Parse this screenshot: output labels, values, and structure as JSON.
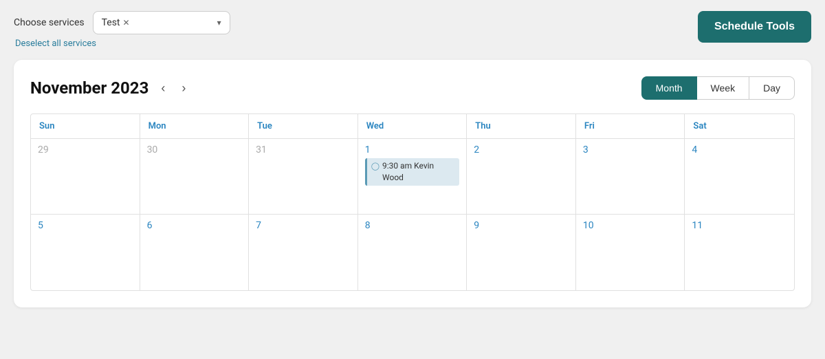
{
  "topBar": {
    "chooseServicesLabel": "Choose services",
    "serviceTag": "Test",
    "deselectAllLabel": "Deselect all services",
    "scheduleToolsLabel": "Schedule Tools"
  },
  "calendar": {
    "title": "November 2023",
    "viewButtons": [
      {
        "id": "month",
        "label": "Month",
        "active": true
      },
      {
        "id": "week",
        "label": "Week",
        "active": false
      },
      {
        "id": "day",
        "label": "Day",
        "active": false
      }
    ],
    "dayHeaders": [
      "Sun",
      "Mon",
      "Tue",
      "Wed",
      "Thu",
      "Fri",
      "Sat"
    ],
    "weeks": [
      [
        {
          "date": "29",
          "otherMonth": true,
          "events": []
        },
        {
          "date": "30",
          "otherMonth": true,
          "events": []
        },
        {
          "date": "31",
          "otherMonth": true,
          "events": []
        },
        {
          "date": "1",
          "otherMonth": false,
          "events": [
            {
              "time": "9:30 am",
              "name": "Kevin Wood"
            }
          ]
        },
        {
          "date": "2",
          "otherMonth": false,
          "events": []
        },
        {
          "date": "3",
          "otherMonth": false,
          "events": []
        },
        {
          "date": "4",
          "otherMonth": false,
          "events": []
        }
      ],
      [
        {
          "date": "5",
          "otherMonth": false,
          "events": []
        },
        {
          "date": "6",
          "otherMonth": false,
          "events": []
        },
        {
          "date": "7",
          "otherMonth": false,
          "events": []
        },
        {
          "date": "8",
          "otherMonth": false,
          "events": []
        },
        {
          "date": "9",
          "otherMonth": false,
          "events": []
        },
        {
          "date": "10",
          "otherMonth": false,
          "events": []
        },
        {
          "date": "11",
          "otherMonth": false,
          "events": []
        }
      ]
    ]
  }
}
